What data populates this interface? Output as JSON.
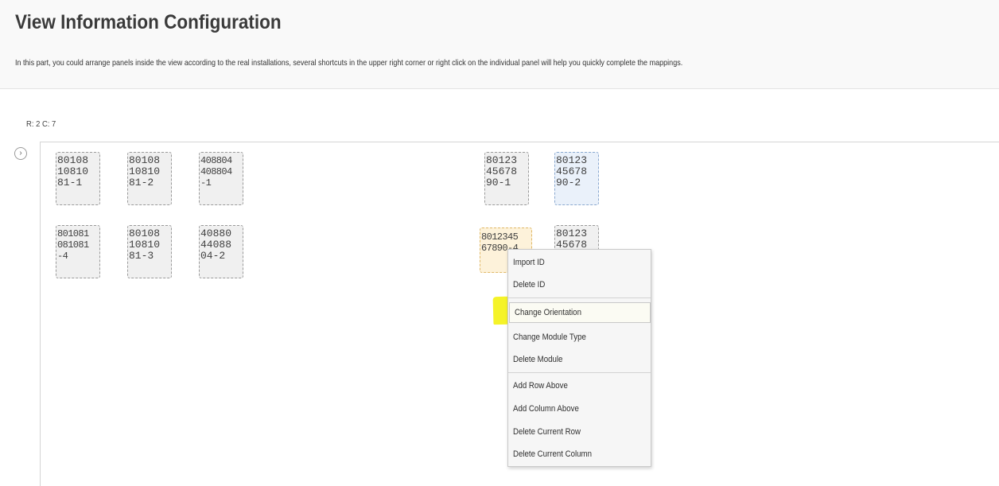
{
  "header": {
    "title": "View Information Configuration",
    "description": "In this part, you could arrange panels inside the view according to the real installations, several shortcuts in the upper right corner or right click on the individual panel will help you quickly complete the mappings."
  },
  "grid_info": "R: 2 C: 7",
  "sidebar_toggle_icon": "chevron-right-icon",
  "toggle_glyph": "›",
  "panels": [
    {
      "lines": [
        "80108",
        "10810",
        "81-1"
      ]
    },
    {
      "lines": [
        "80108",
        "10810",
        "81-2"
      ]
    },
    {
      "lines": [
        "408804",
        "408804",
        "-1"
      ]
    },
    {
      "lines": [
        "80123",
        "45678",
        "90-1"
      ]
    },
    {
      "lines": [
        "80123",
        "45678",
        "90-2"
      ]
    },
    {
      "lines": [
        "801081",
        "081081",
        "-4"
      ]
    },
    {
      "lines": [
        "80108",
        "10810",
        "81-3"
      ]
    },
    {
      "lines": [
        "40880",
        "44088",
        "04-2"
      ]
    },
    {
      "lines": [
        "8012345",
        "67890-4"
      ]
    },
    {
      "lines": [
        "80123",
        "45678"
      ]
    }
  ],
  "context_menu": {
    "items": [
      "Import ID",
      "Delete ID",
      "Change Orientation",
      "Change Module Type",
      "Delete Module",
      "Add Row Above",
      "Add Column Above",
      "Delete Current Row",
      "Delete Current Column"
    ],
    "highlighted_item": "Change Orientation",
    "highlight_color": "#f4f21e"
  },
  "colors": {
    "panel_default": "#f0f0f0",
    "panel_selected_blue": "#eaf1fa",
    "panel_selected_orange": "#fdf2da"
  }
}
